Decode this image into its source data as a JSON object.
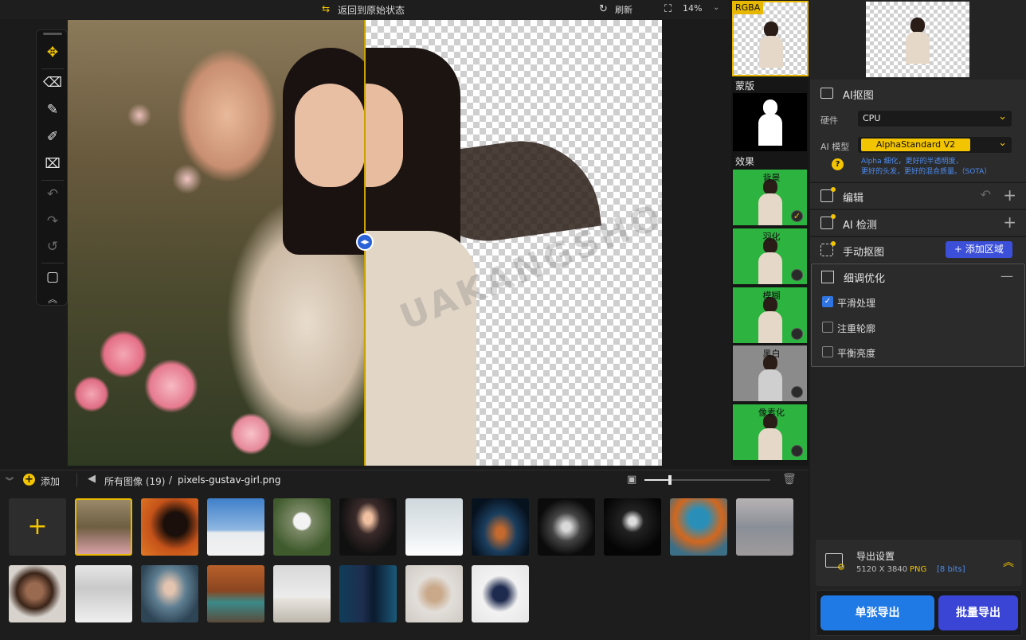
{
  "topbar": {
    "revert_label": "返回到原始状态",
    "refresh_label": "刷新",
    "zoom": "14%"
  },
  "strip": {
    "rgba_label": "RGBA",
    "mask_label": "蒙版",
    "effects_label": "效果",
    "effects": [
      {
        "label": "背景",
        "selected": true
      },
      {
        "label": "羽化",
        "selected": false
      },
      {
        "label": "模糊",
        "selected": false
      },
      {
        "label": "黑白",
        "selected": false
      },
      {
        "label": "像素化",
        "selected": false
      }
    ]
  },
  "panel": {
    "ai_cutout": {
      "title": "AI抠图",
      "hardware_label": "硬件",
      "hardware_value": "CPU",
      "model_label": "AI 模型",
      "model_value": "AlphaStandard  V2",
      "model_desc_line1": "Alpha 细化，更好的半透明度，",
      "model_desc_line2": "更好的头发，更好的混合质量。（SOTA）"
    },
    "edit_title": "编辑",
    "ai_detect_title": "AI 检测",
    "manual_title": "手动抠图",
    "add_region_label": "添加区域",
    "refine": {
      "title": "细调优化",
      "options": [
        {
          "label": "平滑处理",
          "checked": true
        },
        {
          "label": "注重轮廓",
          "checked": false
        },
        {
          "label": "平衡亮度",
          "checked": false
        }
      ]
    },
    "export": {
      "title": "导出设置",
      "dimensions": "5120 X 3840",
      "format": "PNG",
      "bits": "[8 bits]",
      "single_label": "单张导出",
      "batch_label": "批量导出"
    }
  },
  "bottombar": {
    "add_label": "添加",
    "all_images": "所有图像 (19)",
    "separator": "/",
    "filename": "pixels-gustav-girl.png",
    "thumb_size_level": 0.2
  },
  "watermark": {
    "text": "UAKANGSHOU.COM"
  },
  "colors": {
    "accent_yellow": "#f3c400",
    "accent_blue": "#2f74e0",
    "effect_green": "#2db33f"
  }
}
